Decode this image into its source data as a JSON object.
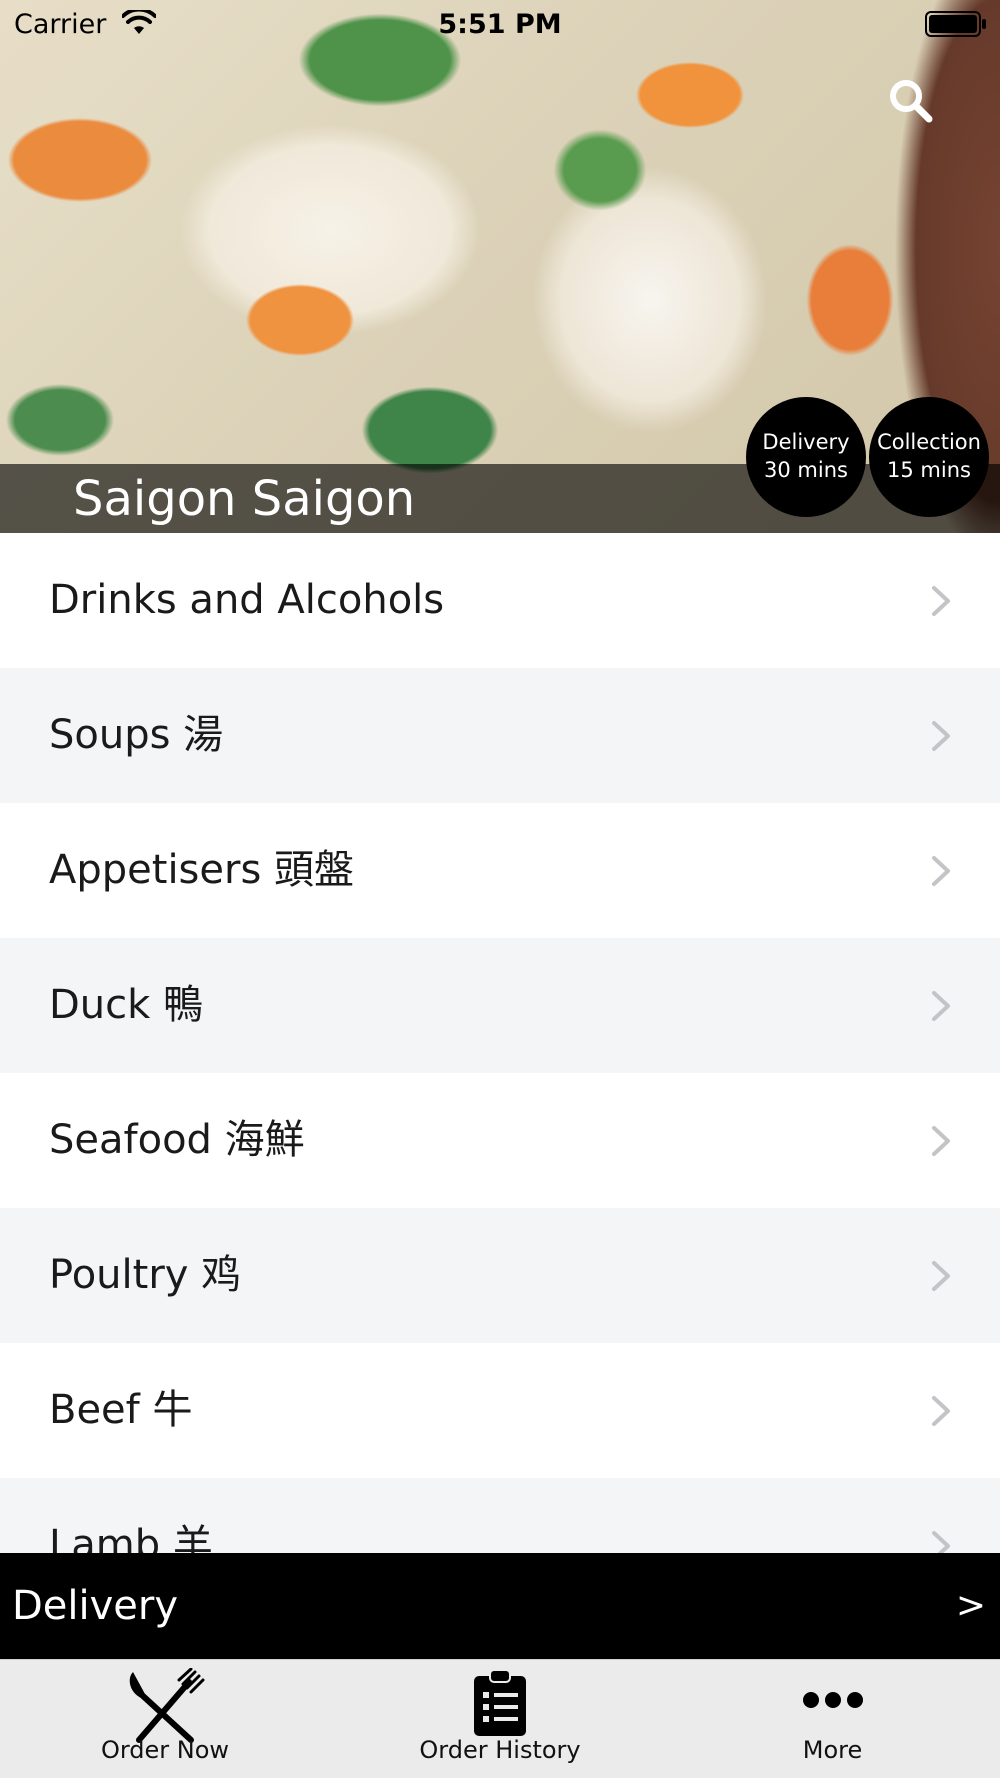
{
  "status_bar": {
    "carrier": "Carrier",
    "time": "5:51 PM"
  },
  "hero": {
    "restaurant_name": "Saigon Saigon",
    "search_icon": "search-icon",
    "badges": {
      "delivery": {
        "label": "Delivery",
        "time": "30 mins"
      },
      "collection": {
        "label": "Collection",
        "time": "15 mins"
      }
    }
  },
  "menu": {
    "items": [
      {
        "label": "Drinks and Alcohols"
      },
      {
        "label": "Soups 湯"
      },
      {
        "label": "Appetisers 頭盤"
      },
      {
        "label": "Duck 鴨"
      },
      {
        "label": "Seafood 海鮮"
      },
      {
        "label": "Poultry 鸡"
      },
      {
        "label": "Beef 牛"
      },
      {
        "label": "Lamb 羊"
      }
    ]
  },
  "delivery_bar": {
    "label": "Delivery",
    "arrow": ">"
  },
  "tab_bar": {
    "tabs": [
      {
        "label": "Order Now",
        "icon": "fork-knife-icon"
      },
      {
        "label": "Order History",
        "icon": "clipboard-icon"
      },
      {
        "label": "More",
        "icon": "more-dots-icon"
      }
    ]
  },
  "colors": {
    "accent": "#000000",
    "list_alt_row": "#f4f5f7",
    "tab_bar_bg": "#ebebeb"
  }
}
